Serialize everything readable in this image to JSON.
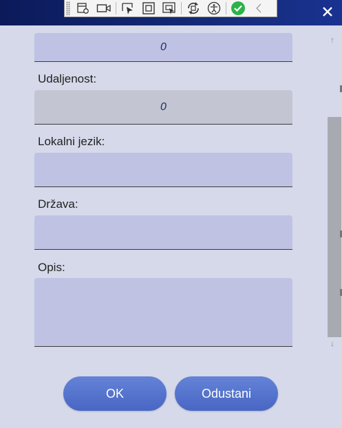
{
  "devtools": {
    "icons": [
      "select-element-icon",
      "video-icon",
      "pointer-icon",
      "box-icon",
      "layout-icon",
      "hot-reload-icon",
      "accessibility-icon",
      "check-icon",
      "chevron-left-icon"
    ]
  },
  "form": {
    "top_value": "0",
    "distance_label": "Udaljenost:",
    "distance_value": "0",
    "local_language_label": "Lokalni jezik:",
    "local_language_value": "",
    "country_label": "Država:",
    "country_value": "",
    "description_label": "Opis:",
    "description_value": ""
  },
  "buttons": {
    "ok_label": "OK",
    "cancel_label": "Odustani"
  },
  "colors": {
    "title_bar": "#142a78",
    "field_bg": "#bfc2e3",
    "button_bg": "#5574cc",
    "check_green": "#2bb34a"
  }
}
